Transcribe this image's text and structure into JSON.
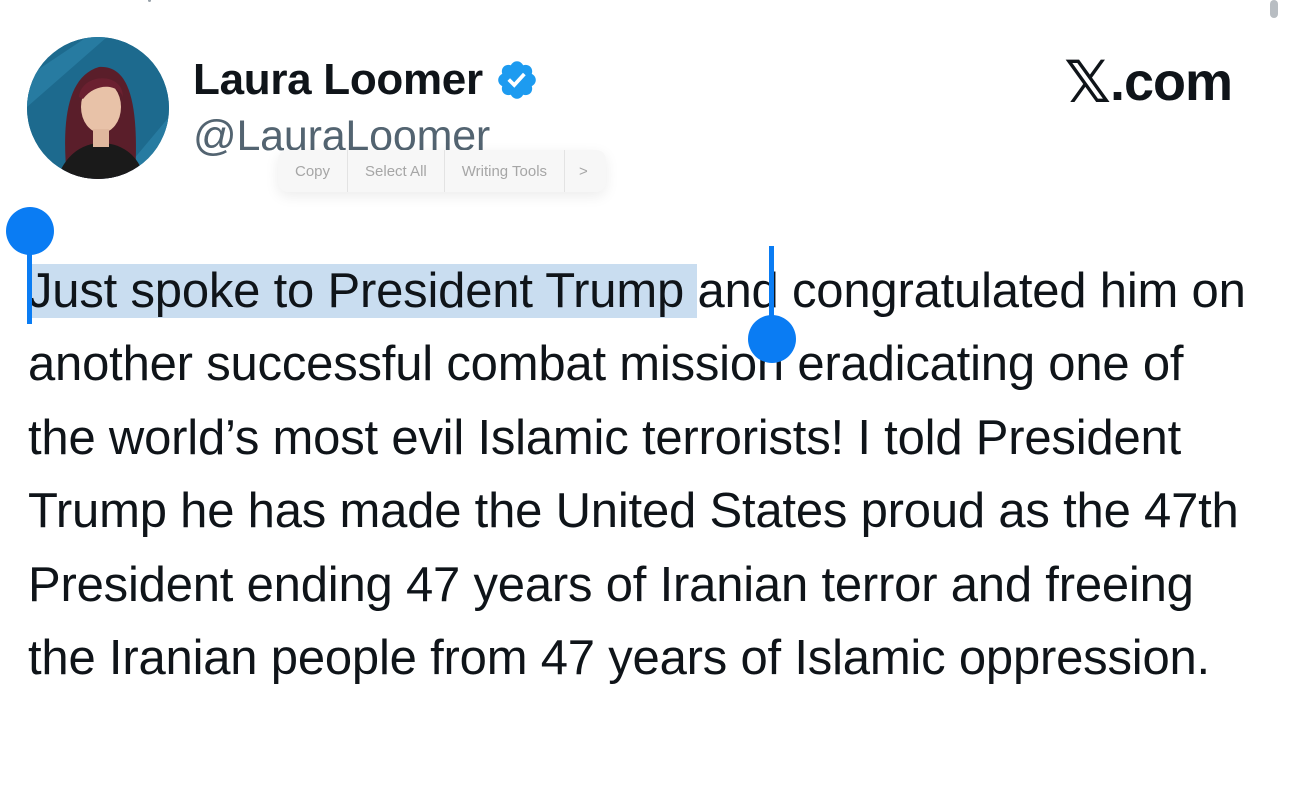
{
  "author": {
    "display_name": "Laura Loomer",
    "handle": "@LauraLoomer",
    "verified": true
  },
  "brand": {
    "label": ".com"
  },
  "context_menu": {
    "items": [
      "Copy",
      "Select All",
      "Writing Tools",
      ">"
    ]
  },
  "tweet": {
    "selected_text": "Just spoke to President Trump ",
    "remaining_text": "and congratulated him on another successful combat mission eradicating one of the world’s most evil Islamic terrorists! I told President Trump he has made the United States proud as the 47th President ending 47 years of Iranian terror and freeing the Iranian people from 47 years of Islamic oppression."
  },
  "colors": {
    "accent": "#0a7cf3",
    "selection": "#c9ddf0",
    "verified_badge": "#1d9bf0",
    "handle_text": "#536471"
  }
}
